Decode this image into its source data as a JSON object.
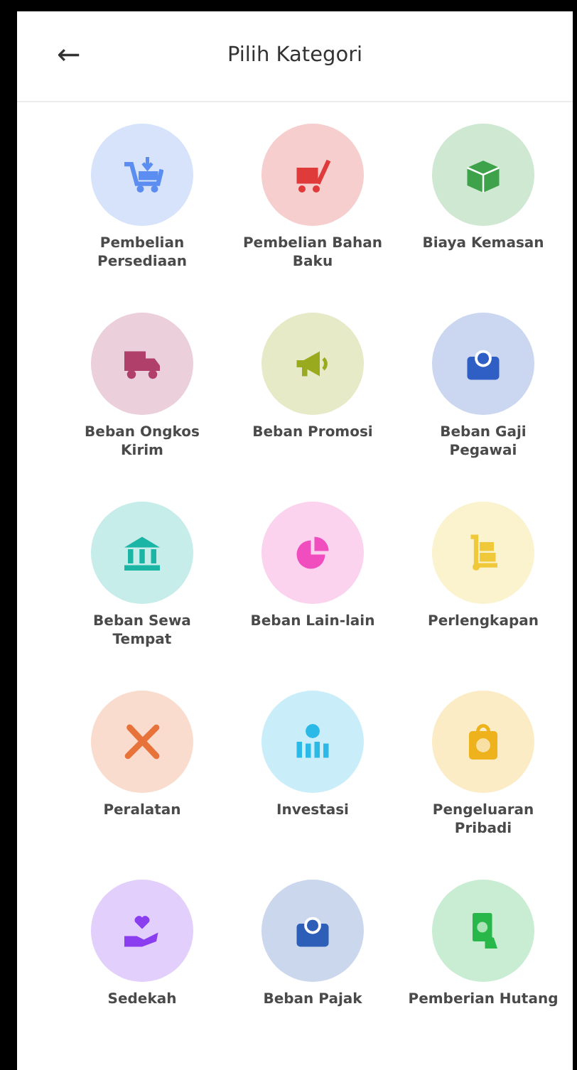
{
  "header": {
    "back": "←",
    "title": "Pilih Kategori"
  },
  "categories": [
    {
      "label": "Pembelian Persediaan",
      "color": "#5b8ef0"
    },
    {
      "label": "Pembelian Bahan Baku",
      "color": "#e03b3b"
    },
    {
      "label": "Biaya Kemasan",
      "color": "#3ea24a"
    },
    {
      "label": "Beban Ongkos Kirim",
      "color": "#b0406a"
    },
    {
      "label": "Beban Promosi",
      "color": "#9aaa1e"
    },
    {
      "label": "Beban Gaji Pegawai",
      "color": "#2f5fc4"
    },
    {
      "label": "Beban Sewa Tempat",
      "color": "#1bb5a6"
    },
    {
      "label": "Beban Lain-lain",
      "color": "#f04dbf"
    },
    {
      "label": "Perlengkapan",
      "color": "#f0c93a"
    },
    {
      "label": "Peralatan",
      "color": "#e8733a"
    },
    {
      "label": "Investasi",
      "color": "#2bb9e8"
    },
    {
      "label": "Pengeluaran Pribadi",
      "color": "#eeb21c"
    },
    {
      "label": "Sedekah",
      "color": "#8a3ef0"
    },
    {
      "label": "Beban Pajak",
      "color": "#2d5fb8"
    },
    {
      "label": "Pemberian Hutang",
      "color": "#28b84a"
    }
  ]
}
